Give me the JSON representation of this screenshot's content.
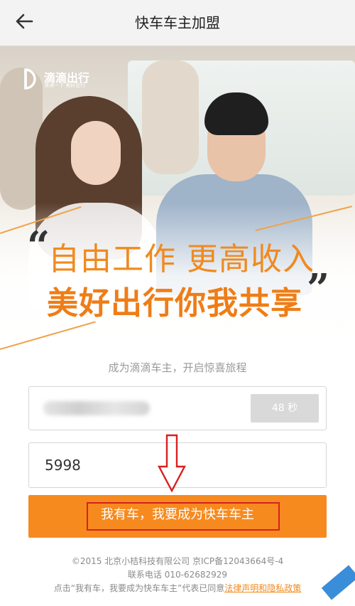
{
  "header": {
    "title": "快车车主加盟",
    "back_icon": "arrow-left-icon"
  },
  "hero": {
    "logo_name": "滴滴出行",
    "logo_sub": "滴滴一下 美好出行",
    "quote_open": "“",
    "quote_close": "”",
    "slogan_line1": "自由工作 更高收入",
    "slogan_line2": "美好出行你我共享",
    "accent_color": "#f08a1f"
  },
  "form": {
    "tagline": "成为滴滴车主，开启惊喜旅程",
    "countdown_label": "48 秒",
    "code_value": "5998",
    "submit_label": "我有车，我要成为快车车主"
  },
  "footer": {
    "copyright": "©2015 北京小桔科技有限公司 京ICP备12043664号-4",
    "phone": "联系电话 010-62682929",
    "agreement_prefix": "点击“我有车，我要成为快车车主”代表已同意",
    "legal_link": "法律声明和隐私政策"
  },
  "colors": {
    "primary_button": "#f68a1f",
    "highlight_border": "#d9201f"
  }
}
